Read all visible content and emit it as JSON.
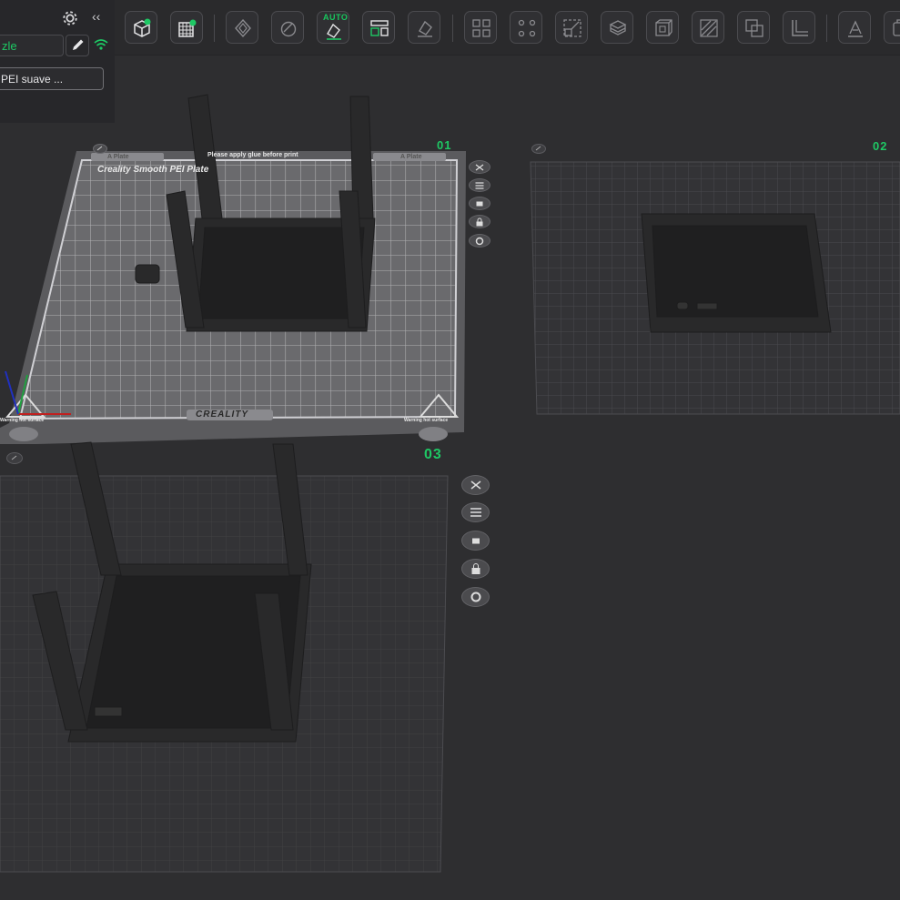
{
  "toolbar": {
    "buttons": [
      {
        "name": "add-object",
        "icon": "cube-plus-icon"
      },
      {
        "name": "add-plate",
        "icon": "grid-plus-icon"
      },
      {
        "name": "auto-arrange",
        "icon": "arrange-icon"
      },
      {
        "name": "orient",
        "icon": "orient-icon"
      },
      {
        "name": "auto-orient",
        "icon": "auto-orient-icon",
        "label": "AUTO"
      },
      {
        "name": "layout",
        "icon": "layout-icon"
      },
      {
        "name": "lay-on-face",
        "icon": "lay-face-icon"
      },
      {
        "name": "split-objects",
        "icon": "split-objects-icon"
      },
      {
        "name": "split-parts",
        "icon": "split-parts-icon"
      },
      {
        "name": "scale",
        "icon": "scale-icon"
      },
      {
        "name": "cut",
        "icon": "cut-icon"
      },
      {
        "name": "hollow",
        "icon": "hollow-icon"
      },
      {
        "name": "support-paint",
        "icon": "support-paint-icon"
      },
      {
        "name": "boolean",
        "icon": "boolean-icon"
      },
      {
        "name": "measure",
        "icon": "measure-icon"
      },
      {
        "name": "emboss",
        "icon": "emboss-icon"
      },
      {
        "name": "more",
        "icon": "more-icon"
      }
    ],
    "auto_label": "AUTO"
  },
  "panel": {
    "nozzle_text": "zle",
    "plate_type": "PEI suave ...",
    "collapse_symbol": "‹‹"
  },
  "plates": [
    {
      "label": "01"
    },
    {
      "label": "02"
    },
    {
      "label": "03"
    }
  ],
  "bed": {
    "title": "Creality Smooth PEI Plate",
    "notice": "Please apply glue before print",
    "brand": "CREALITY",
    "tab_left": "A Plate",
    "tab_right": "A Plate",
    "warning_left": "Warning hot surface",
    "warning_right": "Warning hot surface"
  },
  "colors": {
    "accent": "#1ec864",
    "background": "#2e2e30",
    "model": "#2a2a2b"
  }
}
